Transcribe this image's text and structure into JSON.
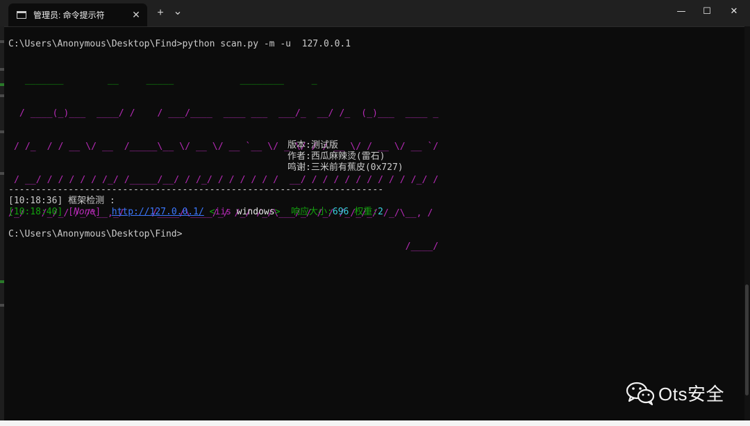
{
  "window": {
    "tab_title": "管理员: 命令提示符",
    "tab_close": "✕",
    "new_tab": "+",
    "dropdown": "⌄",
    "minimize": "—",
    "maximize": "☐",
    "close": "✕"
  },
  "terminal": {
    "command_line": "C:\\Users\\Anonymous\\Desktop\\Find>python scan.py -m -u  127.0.0.1",
    "banner": [
      "   _______        __     _____            ________     _",
      "  / ____(_)___  ____/ /    / ___/____  ____ ___  ___/_  __/ /_  (_)___  ____ _",
      " / /_  / / __ \\/ __  /_____\\__ \\/ __ \\/ __ `__ \\/ _ \\/ / / __ \\/ / __ \\/ __ `/",
      " / __/ / / / / / /_/ /_____/__/ / /_/ / / / / / /  __/ / / / / / / / / / /_/ /",
      "/_/   /_/_/ /_/\\__,_/     /____/\\____/_/ /_/ /_/\\___/_/ /_/ /_/_/_/ /_/\\__, /",
      "                                                                        /____/"
    ],
    "version": "版本:测试版",
    "author": "作者:西瓜麻辣烫(雷石)",
    "thanks": "鸣谢:三米前有蕉皮(0x727)",
    "separator": "---------------------------------------------------------------------",
    "log1_time": "[10:18:36]",
    "log1_text": " 框架检测 :",
    "log2_time": "[10:18:40]",
    "log2_lb": " [",
    "log2_none": "None",
    "log2_rb": "]",
    "log2_url": "http://127.0.0.1/",
    "log2_lt": "<",
    "log2_iis": "iis",
    "log2_win": " windows",
    "log2_gt": ">",
    "log2_size_label": "响应大小:",
    "log2_size": "696",
    "log2_weight_label": "权重:",
    "log2_weight": "2",
    "prompt": "C:\\Users\\Anonymous\\Desktop\\Find>"
  },
  "watermark": "Ots安全",
  "colors": {
    "background": "#0c0c0c",
    "green": "#13a10e",
    "magenta": "#b52ab5",
    "link_blue": "#3b78ff",
    "cyan": "#3ad0e0"
  }
}
